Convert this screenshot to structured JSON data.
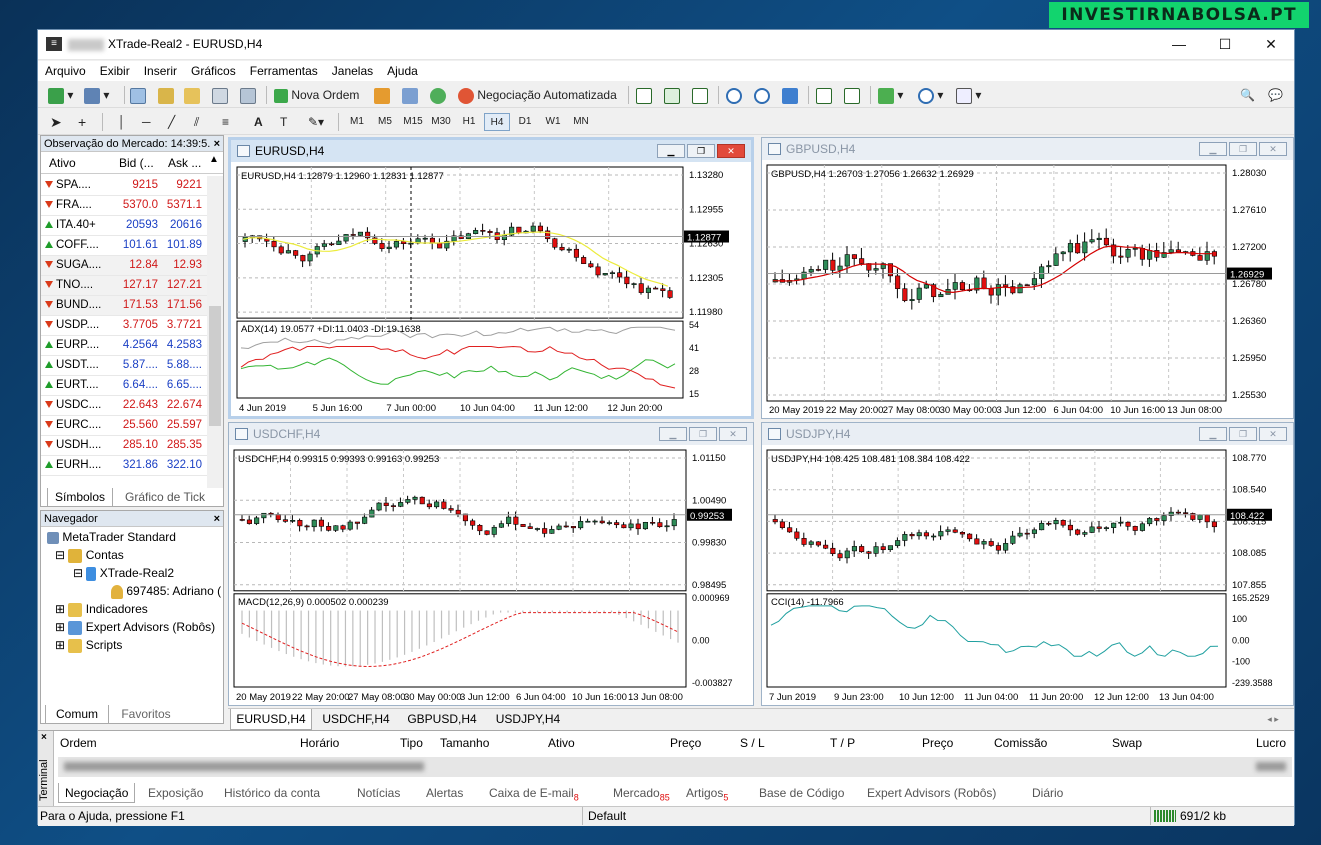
{
  "watermark": "INVESTIRNABOLSA.PT",
  "window": {
    "title": "XTrade-Real2 - EURUSD,H4",
    "min": "—",
    "max": "☐",
    "close": "✕"
  },
  "menu": [
    "Arquivo",
    "Exibir",
    "Inserir",
    "Gráficos",
    "Ferramentas",
    "Janelas",
    "Ajuda"
  ],
  "toolbar": {
    "new_order": "Nova Ordem",
    "auto_trading": "Negociação Automatizada"
  },
  "timeframes": [
    "M1",
    "M5",
    "M15",
    "M30",
    "H1",
    "H4",
    "D1",
    "W1",
    "MN"
  ],
  "selected_timeframe": "H4",
  "market_watch": {
    "title": "Observação do Mercado: 14:39:5.",
    "col_symbol": "Ativo",
    "col_bid": "Bid (...",
    "col_ask": "Ask ...",
    "rows": [
      {
        "sym": "SPA....",
        "bid": "9215",
        "ask": "9221",
        "dir": "dn",
        "color": "red"
      },
      {
        "sym": "FRA....",
        "bid": "5370.0",
        "ask": "5371.1",
        "dir": "dn",
        "color": "red"
      },
      {
        "sym": "ITA.40+",
        "bid": "20593",
        "ask": "20616",
        "dir": "up",
        "color": "blue"
      },
      {
        "sym": "COFF....",
        "bid": "101.61",
        "ask": "101.89",
        "dir": "up",
        "color": "blue"
      },
      {
        "sym": "SUGA....",
        "bid": "12.84",
        "ask": "12.93",
        "dir": "dn",
        "color": "red"
      },
      {
        "sym": "TNO....",
        "bid": "127.17",
        "ask": "127.21",
        "dir": "dn",
        "color": "red"
      },
      {
        "sym": "BUND....",
        "bid": "171.53",
        "ask": "171.56",
        "dir": "dn",
        "color": "red"
      },
      {
        "sym": "USDP....",
        "bid": "3.7705",
        "ask": "3.7721",
        "dir": "dn",
        "color": "red"
      },
      {
        "sym": "EURP....",
        "bid": "4.2564",
        "ask": "4.2583",
        "dir": "up",
        "color": "blue"
      },
      {
        "sym": "USDT....",
        "bid": "5.87....",
        "ask": "5.88....",
        "dir": "up",
        "color": "blue"
      },
      {
        "sym": "EURT....",
        "bid": "6.64....",
        "ask": "6.65....",
        "dir": "up",
        "color": "blue"
      },
      {
        "sym": "USDC....",
        "bid": "22.643",
        "ask": "22.674",
        "dir": "dn",
        "color": "red"
      },
      {
        "sym": "EURC....",
        "bid": "25.560",
        "ask": "25.597",
        "dir": "dn",
        "color": "red"
      },
      {
        "sym": "USDH....",
        "bid": "285.10",
        "ask": "285.35",
        "dir": "dn",
        "color": "red"
      },
      {
        "sym": "EURH....",
        "bid": "321.86",
        "ask": "322.10",
        "dir": "up",
        "color": "blue"
      }
    ],
    "tab_symbols": "Símbolos",
    "tab_tick": "Gráfico de Tick"
  },
  "navigator": {
    "title": "Navegador",
    "root": "MetaTrader Standard",
    "accounts": "Contas",
    "server": "XTrade-Real2",
    "account": "697485: Adriano (",
    "indicators": "Indicadores",
    "experts": "Expert Advisors (Robôs)",
    "scripts": "Scripts",
    "tab_common": "Comum",
    "tab_favorites": "Favoritos"
  },
  "charts": [
    {
      "title": "EURUSD,H4",
      "info": "EURUSD,H4  1.12879 1.12960 1.12831 1.12877",
      "prices": [
        "1.13280",
        "1.12955",
        "1.12630",
        "1.12305",
        "1.11980"
      ],
      "current": "1.12877",
      "ind": "ADX(14) 19.0577 +DI:11.0403 -DI:19.1638",
      "ind_scale": [
        "54",
        "41",
        "28",
        "15"
      ],
      "dates": [
        "4 Jun 2019",
        "5 Jun 16:00",
        "7 Jun 00:00",
        "10 Jun 04:00",
        "11 Jun 12:00",
        "12 Jun 20:00"
      ]
    },
    {
      "title": "GBPUSD,H4",
      "info": "GBPUSD,H4  1.26703 1.27056 1.26632 1.26929",
      "prices": [
        "1.28030",
        "1.27610",
        "1.27200",
        "1.26780",
        "1.26360",
        "1.25950",
        "1.25530"
      ],
      "current": "1.26929",
      "dates": [
        "20 May 2019",
        "22 May 20:00",
        "27 May 08:00",
        "30 May 00:00",
        "3 Jun 12:00",
        "6 Jun 04:00",
        "10 Jun 16:00",
        "13 Jun 08:00"
      ]
    },
    {
      "title": "USDCHF,H4",
      "info": "USDCHF,H4  0.99315 0.99393 0.99163 0.99253",
      "prices": [
        "1.01150",
        "1.00490",
        "0.99830",
        "0.98495"
      ],
      "current": "0.99253",
      "ind": "MACD(12,26,9) 0.000502 0.000239",
      "ind_scale": [
        "0.000969",
        "0.00",
        "-0.003827"
      ],
      "dates": [
        "20 May 2019",
        "22 May 20:00",
        "27 May 08:00",
        "30 May 00:00",
        "3 Jun 12:00",
        "6 Jun 04:00",
        "10 Jun 16:00",
        "13 Jun 08:00"
      ]
    },
    {
      "title": "USDJPY,H4",
      "info": "USDJPY,H4  108.425 108.481 108.384 108.422",
      "prices": [
        "108.770",
        "108.540",
        "108.315",
        "108.085",
        "107.855"
      ],
      "current": "108.422",
      "ind": "CCI(14) -11.7966",
      "ind_scale": [
        "165.2529",
        "100",
        "0.00",
        "-100",
        "-239.3588"
      ],
      "dates": [
        "7 Jun 2019",
        "9 Jun 23:00",
        "10 Jun 12:00",
        "11 Jun 04:00",
        "11 Jun 20:00",
        "12 Jun 12:00",
        "13 Jun 04:00"
      ]
    }
  ],
  "chart_tabs": [
    "EURUSD,H4",
    "USDCHF,H4",
    "GBPUSD,H4",
    "USDJPY,H4"
  ],
  "terminal": {
    "side": "Terminal",
    "cols": [
      "Ordem",
      "Horário",
      "Tipo",
      "Tamanho",
      "Ativo",
      "Preço",
      "S / L",
      "T / P",
      "Preço",
      "Comissão",
      "Swap",
      "Lucro"
    ],
    "tabs": [
      {
        "label": "Negociação",
        "badge": ""
      },
      {
        "label": "Exposição",
        "badge": ""
      },
      {
        "label": "Histórico da conta",
        "badge": ""
      },
      {
        "label": "Notícias",
        "badge": ""
      },
      {
        "label": "Alertas",
        "badge": ""
      },
      {
        "label": "Caixa de E-mail",
        "badge": "8"
      },
      {
        "label": "Mercado",
        "badge": "85"
      },
      {
        "label": "Artigos",
        "badge": "5"
      },
      {
        "label": "Base de Código",
        "badge": ""
      },
      {
        "label": "Expert Advisors (Robôs)",
        "badge": ""
      },
      {
        "label": "Diário",
        "badge": ""
      }
    ]
  },
  "status": {
    "help": "Para o Ajuda, pressione F1",
    "profile": "Default",
    "traffic": "691/2 kb"
  }
}
